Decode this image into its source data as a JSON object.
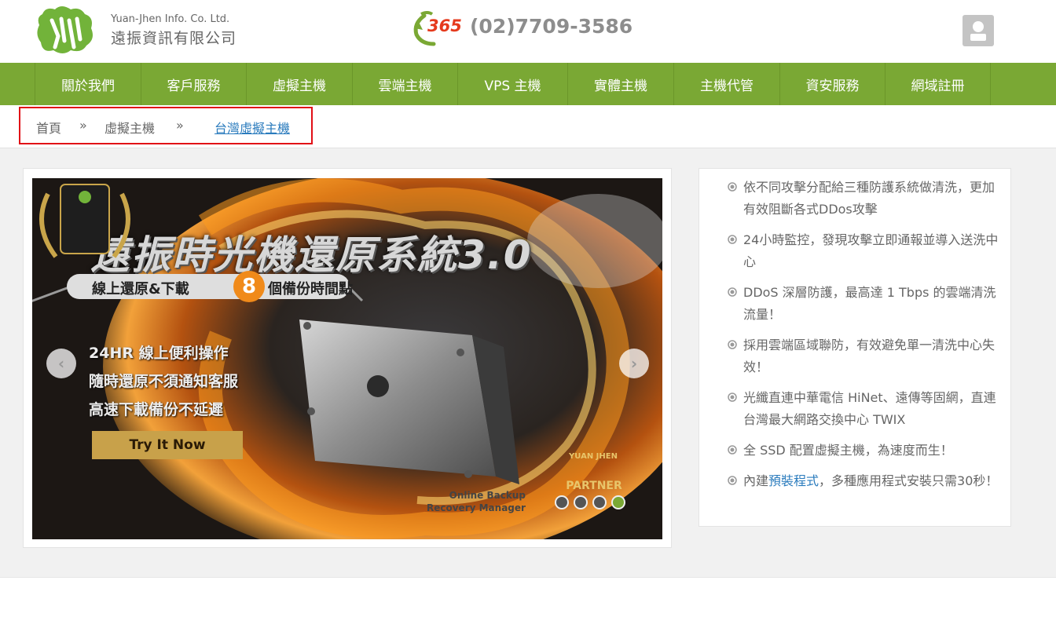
{
  "header": {
    "company_en": "Yuan-Jhen Info. Co. Ltd.",
    "company_cn": "遠振資訊有限公司",
    "phone_prefix": "365",
    "phone_number": "(02)7709-3586",
    "icons": [
      "logo-mark",
      "phone-icon",
      "user-icon"
    ]
  },
  "nav": {
    "items": [
      "關於我們",
      "客戶服務",
      "虛擬主機",
      "雲端主機",
      "VPS 主機",
      "實體主機",
      "主機代管",
      "資安服務",
      "網域註冊"
    ]
  },
  "breadcrumb": {
    "items": [
      "首頁",
      "虛擬主機",
      "台灣虛擬主機"
    ],
    "separator": "»"
  },
  "slider": {
    "title": "遠振時光機還原系統3.0",
    "subtitle_left": "線上還原&下載",
    "subtitle_num": "8",
    "subtitle_right": "個備份時間點",
    "bullets": [
      "24HR 線上便利操作",
      "隨時還原不須通知客服",
      "高速下載備份不延遲"
    ],
    "cta": "Try It Now",
    "product_caption_1": "Online Backup",
    "product_caption_2": "Recovery Manager",
    "badge_small": "YUAN JHEN",
    "badge_big": "PARTNER",
    "prev_label": "‹",
    "next_label": "›",
    "dot_count": 4,
    "active_dot": 4
  },
  "features": {
    "items": [
      "依不同攻擊分配給三種防護系統做清洗，更加有效阻斷各式DDos攻擊",
      "24小時監控，發現攻擊立即通報並導入送洗中心",
      "DDoS 深層防護，最高達 1 Tbps 的雲端清洗流量！",
      "採用雲端區域聯防，有效避免單一清洗中心失效！",
      "光纖直連中華電信 HiNet、遠傳等固網，直連台灣最大網路交換中心 TWIX",
      "全 SSD 配置虛擬主機，為速度而生！"
    ],
    "last_prefix": "內建",
    "last_link": "預裝程式",
    "last_suffix": "，多種應用程式安裝只需30秒！"
  },
  "colors": {
    "nav_green": "#7aa834",
    "breadcrumb_highlight": "#e10f16",
    "link_blue": "#2a7bbd",
    "phone_red": "#e53a1d"
  }
}
